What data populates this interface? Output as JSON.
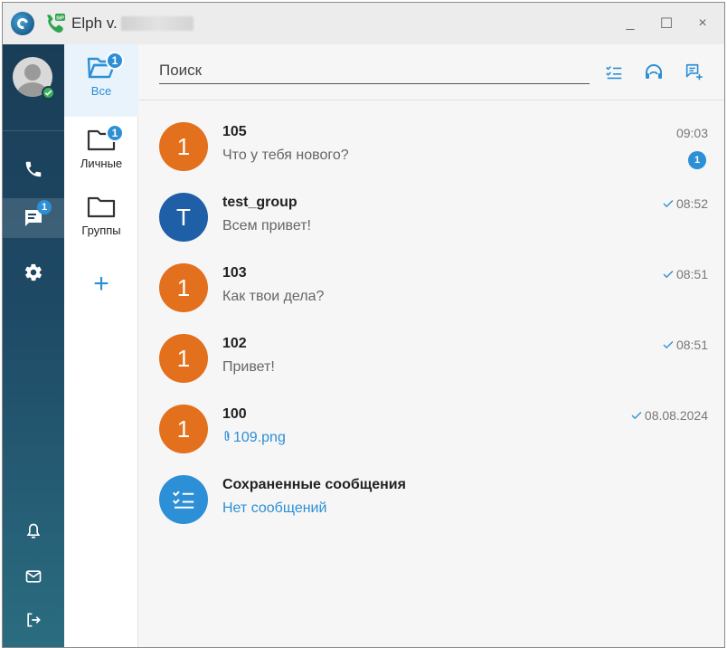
{
  "window": {
    "title": "Elph v.",
    "controls": {
      "minimize": "_",
      "maximize": "☐",
      "close": "×"
    }
  },
  "rail": {
    "items": [
      {
        "name": "calls",
        "icon": "phone-icon"
      },
      {
        "name": "chats",
        "icon": "chat-icon",
        "badge": "1",
        "active": true
      },
      {
        "name": "settings",
        "icon": "gear-icon"
      },
      {
        "name": "notifications",
        "icon": "bell-icon"
      },
      {
        "name": "mail",
        "icon": "mail-icon"
      },
      {
        "name": "logout",
        "icon": "logout-icon"
      }
    ]
  },
  "folders": {
    "items": [
      {
        "label": "Все",
        "badge": "1",
        "active": true
      },
      {
        "label": "Личные",
        "badge": "1"
      },
      {
        "label": "Группы"
      }
    ],
    "add_label": "+"
  },
  "search": {
    "placeholder": "Поиск"
  },
  "chats": [
    {
      "avatar_letter": "1",
      "avatar_color": "#e3701c",
      "name": "105",
      "message": "Что у тебя нового?",
      "time": "09:03",
      "sent": false,
      "unread": "1"
    },
    {
      "avatar_letter": "T",
      "avatar_color": "#1f5fa8",
      "name": "test_group",
      "message": "Всем привет!",
      "time": "08:52",
      "sent": true
    },
    {
      "avatar_letter": "1",
      "avatar_color": "#e3701c",
      "name": "103",
      "message": "Как твои дела?",
      "time": "08:51",
      "sent": true
    },
    {
      "avatar_letter": "1",
      "avatar_color": "#e3701c",
      "name": "102",
      "message": "Привет!",
      "time": "08:51",
      "sent": true
    },
    {
      "avatar_letter": "1",
      "avatar_color": "#e3701c",
      "name": "100",
      "message": "109.png",
      "attachment": true,
      "time": "08.08.2024",
      "sent": true
    },
    {
      "avatar_icon": "checklist-icon",
      "avatar_color": "#2d8fd6",
      "name": "Сохраненные сообщения",
      "message": "Нет сообщений",
      "link": true,
      "time": ""
    }
  ],
  "colors": {
    "accent": "#2d8fd6",
    "orange": "#e3701c",
    "rail_top": "#1a3d57",
    "rail_bottom": "#2b6d80"
  }
}
